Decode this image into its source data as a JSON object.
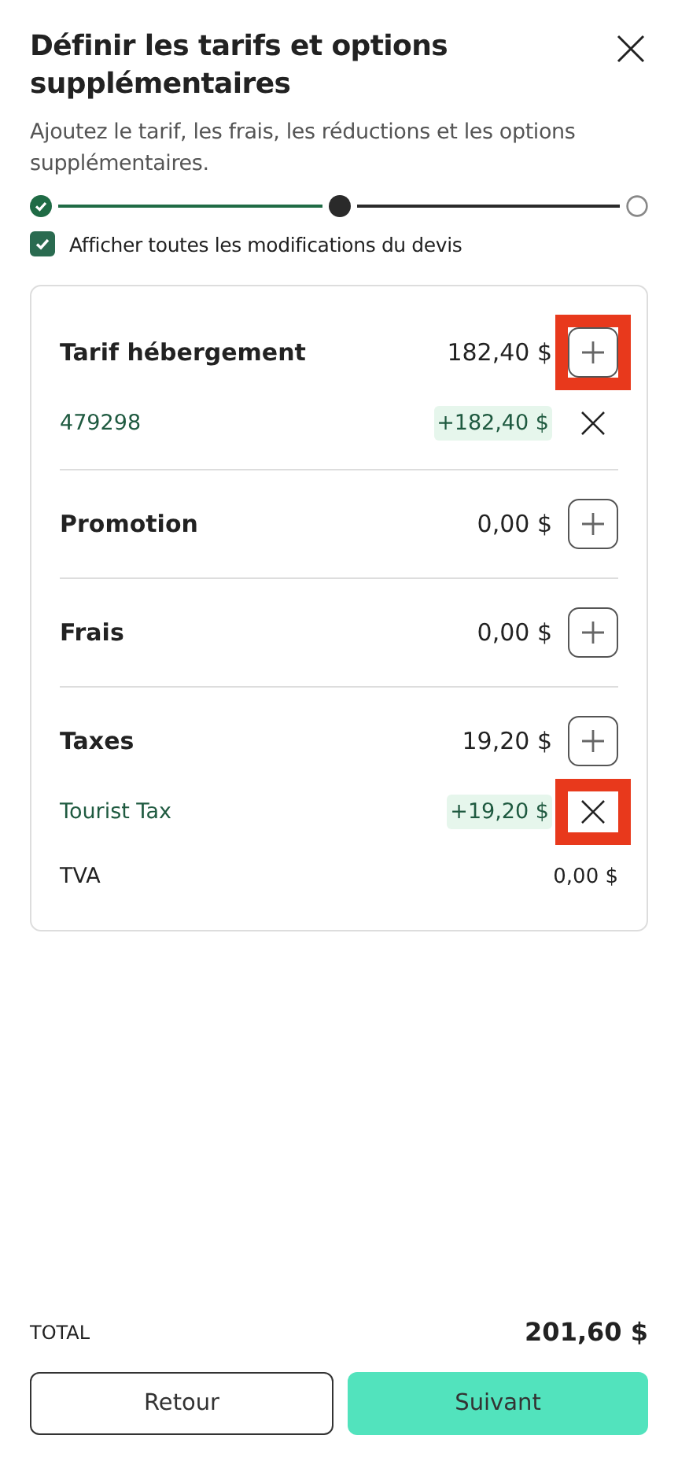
{
  "dialog": {
    "title": "Définir les tarifs et options supplémentaires",
    "subtitle": "Ajoutez le tarif, les frais, les réductions et les options supplémentaires."
  },
  "stepper": [
    {
      "completed": true,
      "selected": false
    },
    {
      "completed": false,
      "selected": true
    },
    {
      "completed": false,
      "selected": false
    }
  ],
  "show_all_changes": {
    "label": "Afficher toutes les modifications du devis",
    "checked": true
  },
  "sections": [
    {
      "title": "Tarif hébergement",
      "amount": "182,40 $",
      "add_highlighted": true,
      "items": [
        {
          "kind": "added",
          "name": "479298",
          "amount": "+182,40 $",
          "remove_highlighted": false
        }
      ]
    },
    {
      "title": "Promotion",
      "amount": "0,00 $",
      "add_highlighted": false
    },
    {
      "title": "Frais",
      "amount": "0,00 $",
      "add_highlighted": false
    },
    {
      "title": "Taxes",
      "amount": "19,20 $",
      "add_highlighted": false,
      "items": [
        {
          "kind": "added",
          "name": "Tourist Tax",
          "amount": "+19,20 $",
          "remove_highlighted": true
        },
        {
          "kind": "plain",
          "name": "TVA",
          "amount": "0,00 $"
        }
      ]
    }
  ],
  "total": {
    "label": "TOTAL",
    "amount": "201,60 $"
  },
  "buttons": {
    "back": "Retour",
    "next": "Suivant"
  }
}
